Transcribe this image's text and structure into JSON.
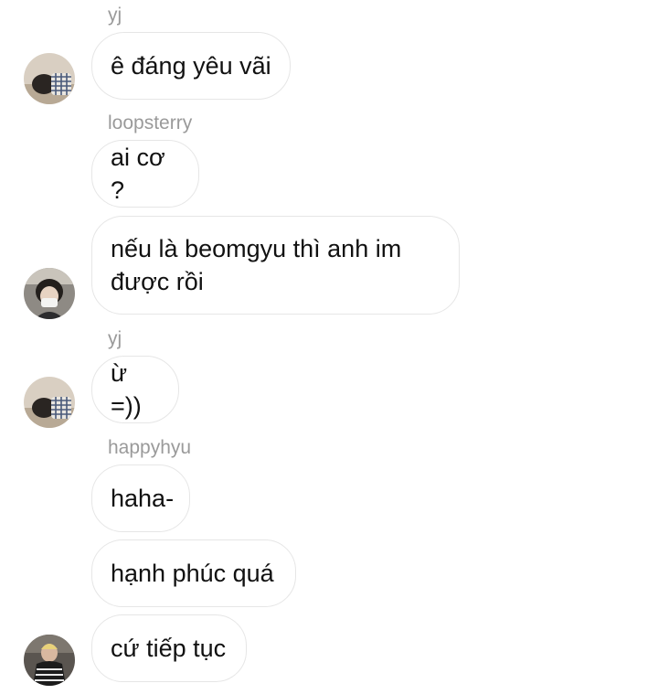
{
  "messages": [
    {
      "sender": "yj"
    },
    {
      "text": "ê đáng yêu vãi"
    },
    {
      "sender": "loopsterry"
    },
    {
      "text": "ai cơ ?"
    },
    {
      "text": "nếu là beomgyu thì anh im\nđược rồi"
    },
    {
      "sender": "yj"
    },
    {
      "text": "ừ =))"
    },
    {
      "sender": "happyhyu"
    },
    {
      "text": "haha-"
    },
    {
      "text": "hạnh phúc quá"
    },
    {
      "text": "cứ tiếp tục"
    }
  ],
  "avatars": [
    {
      "icon": "avatar-yj-icon"
    },
    {
      "icon": "avatar-loopsterry-icon"
    },
    {
      "icon": "avatar-yj-icon"
    },
    {
      "icon": "avatar-happyhyu-icon"
    }
  ]
}
